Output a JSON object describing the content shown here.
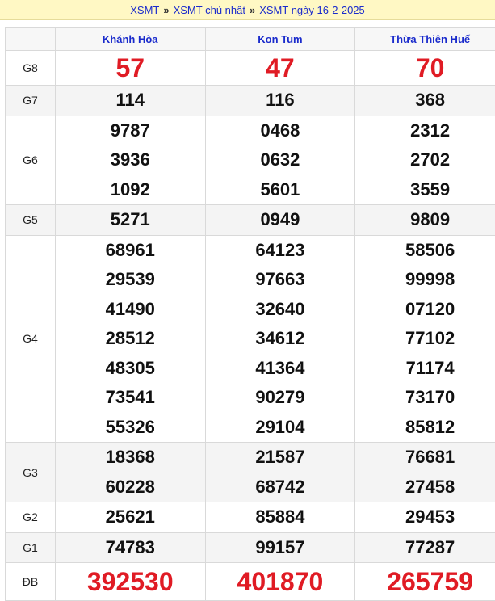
{
  "breadcrumb": {
    "items": [
      "XSMT",
      "XSMT chủ nhật",
      "XSMT ngày 16-2-2025"
    ],
    "separator": "»"
  },
  "columns": [
    "Khánh Hòa",
    "Kon Tum",
    "Thừa Thiên Huế"
  ],
  "rows": [
    {
      "label": "G8",
      "values": [
        [
          "57"
        ],
        [
          "47"
        ],
        [
          "70"
        ]
      ]
    },
    {
      "label": "G7",
      "values": [
        [
          "114"
        ],
        [
          "116"
        ],
        [
          "368"
        ]
      ]
    },
    {
      "label": "G6",
      "values": [
        [
          "9787",
          "3936",
          "1092"
        ],
        [
          "0468",
          "0632",
          "5601"
        ],
        [
          "2312",
          "2702",
          "3559"
        ]
      ]
    },
    {
      "label": "G5",
      "values": [
        [
          "5271"
        ],
        [
          "0949"
        ],
        [
          "9809"
        ]
      ]
    },
    {
      "label": "G4",
      "values": [
        [
          "68961",
          "29539",
          "41490",
          "28512",
          "48305",
          "73541",
          "55326"
        ],
        [
          "64123",
          "97663",
          "32640",
          "34612",
          "41364",
          "90279",
          "29104"
        ],
        [
          "58506",
          "99998",
          "07120",
          "77102",
          "71174",
          "73170",
          "85812"
        ]
      ]
    },
    {
      "label": "G3",
      "values": [
        [
          "18368",
          "60228"
        ],
        [
          "21587",
          "68742"
        ],
        [
          "76681",
          "27458"
        ]
      ]
    },
    {
      "label": "G2",
      "values": [
        [
          "25621"
        ],
        [
          "85884"
        ],
        [
          "29453"
        ]
      ]
    },
    {
      "label": "G1",
      "values": [
        [
          "74783"
        ],
        [
          "99157"
        ],
        [
          "77287"
        ]
      ]
    },
    {
      "label": "ĐB",
      "values": [
        [
          "392530"
        ],
        [
          "401870"
        ],
        [
          "265759"
        ]
      ]
    }
  ],
  "colors": {
    "highlight": "#e01b24",
    "link": "#1a2bcc",
    "crumb_bg": "#fff8c4"
  }
}
